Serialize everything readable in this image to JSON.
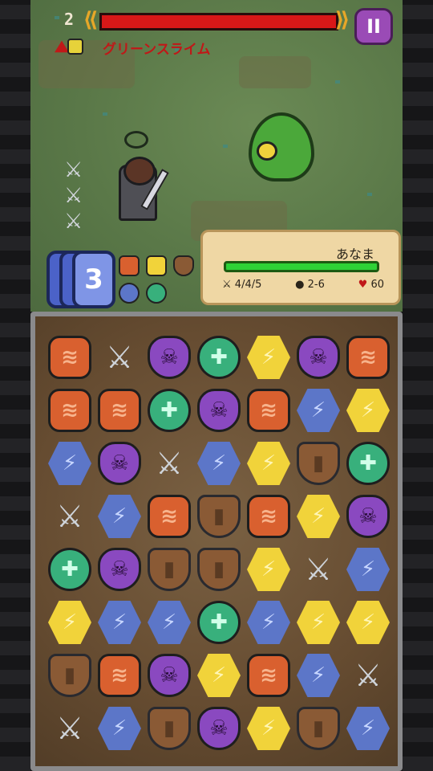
{
  "hud": {
    "level": "2",
    "enemy_name": "グリーンスライム",
    "pause_icon": "pause-icon",
    "enemy_hp_color": "#d81818"
  },
  "player_panel": {
    "name": "あなま",
    "stats": {
      "attack": "4/4/5",
      "defense": "2-6",
      "hp": "60"
    }
  },
  "cards": {
    "count": "3"
  },
  "board": {
    "rows": [
      [
        "fire",
        "sword",
        "dark",
        "heal",
        "light",
        "dark",
        "fire"
      ],
      [
        "fire",
        "fire",
        "heal",
        "dark",
        "fire",
        "water",
        "light"
      ],
      [
        "water",
        "dark",
        "sword",
        "water",
        "light",
        "shield",
        "heal"
      ],
      [
        "sword",
        "water",
        "fire",
        "shield",
        "fire",
        "light",
        "dark"
      ],
      [
        "heal",
        "dark",
        "shield",
        "shield",
        "light",
        "sword",
        "water"
      ],
      [
        "light",
        "water",
        "water",
        "heal",
        "water",
        "light",
        "light"
      ],
      [
        "shield",
        "fire",
        "dark",
        "light",
        "fire",
        "water",
        "sword"
      ],
      [
        "sword",
        "water",
        "shield",
        "dark",
        "light",
        "shield",
        "water"
      ]
    ],
    "glyphs": {
      "fire": "≋",
      "water": "⚡",
      "light": "⚡",
      "heal": "✚",
      "dark": "☠",
      "shield": "▮",
      "sword": "⚔"
    }
  }
}
